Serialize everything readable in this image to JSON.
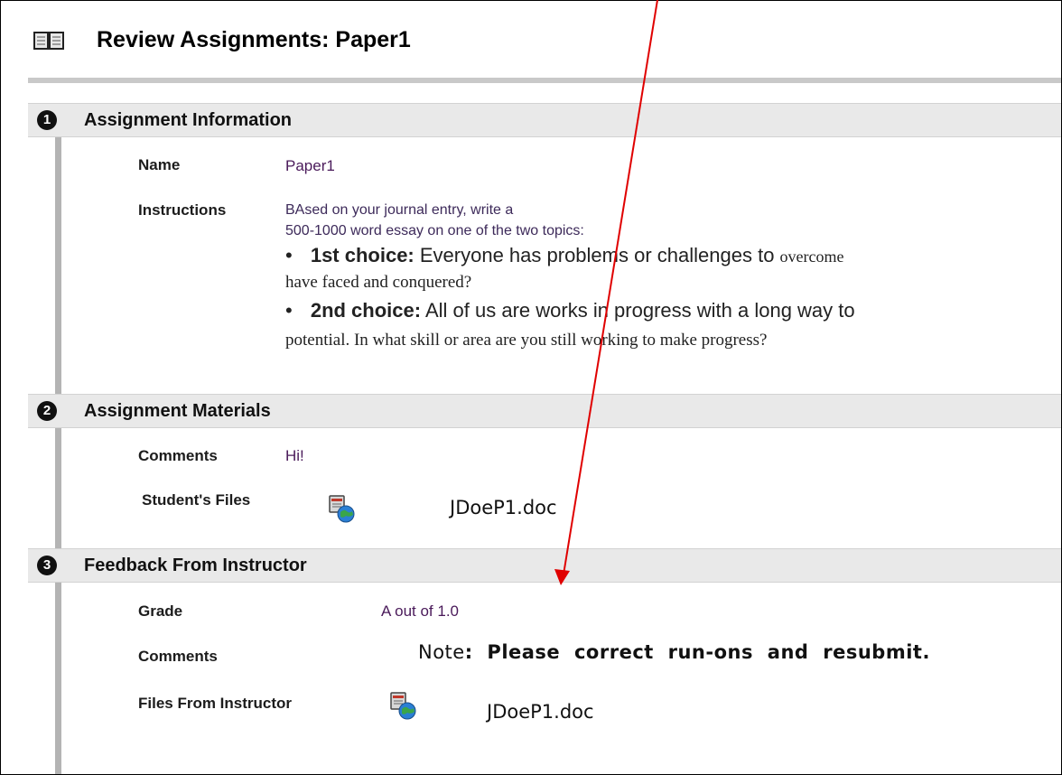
{
  "header": {
    "title": "Review Assignments: Paper1",
    "icon": "book-icon"
  },
  "sections": [
    {
      "number": "1",
      "title": "Assignment Information"
    },
    {
      "number": "2",
      "title": "Assignment Materials"
    },
    {
      "number": "3",
      "title": "Feedback From Instructor"
    }
  ],
  "info": {
    "name_label": "Name",
    "name_value": "Paper1",
    "instructions_label": "Instructions",
    "instructions_line1": "BAsed on your journal entry, write a",
    "instructions_line2": "500-1000 word essay on one of the two topics:",
    "choice1_bullet": "•",
    "choice1_title": "1st choice:",
    "choice1_text": " Everyone has problems or challenges to ",
    "choice1_tail": "overcome",
    "choice1_line2": "have faced and conquered?",
    "choice2_bullet": "•",
    "choice2_title": "2nd choice:",
    "choice2_text": " All of us are works in progress with a long way to",
    "choice2_line2": "potential. In what skill or area are you still working to make progress?"
  },
  "materials": {
    "comments_label": "Comments",
    "comments_value": "Hi!",
    "files_label": "Student's Files",
    "file_name": "JDoeP1.doc",
    "file_icon": "document-globe-icon"
  },
  "feedback": {
    "grade_label": "Grade",
    "grade_value": "A out of 1.0",
    "comments_label": "Comments",
    "note_prefix": "Note",
    "note_text": ": Please correct run-ons and resubmit.",
    "files_label": "Files From Instructor",
    "file_name": "JDoeP1.doc",
    "file_icon": "document-globe-icon"
  },
  "annotation": {
    "color": "#e00000",
    "type": "arrow"
  }
}
